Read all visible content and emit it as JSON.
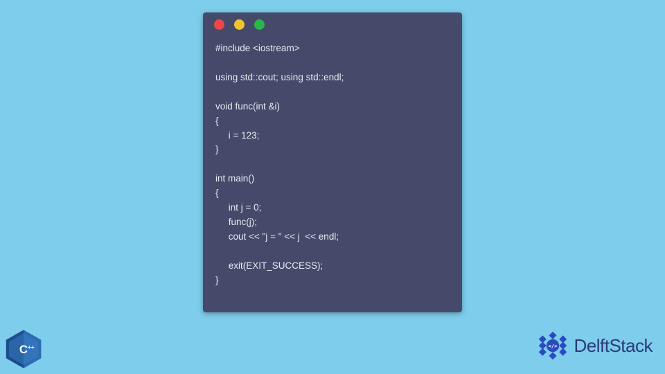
{
  "window": {
    "dots": {
      "red": "#ed4747",
      "yellow": "#f0c22e",
      "green": "#2bb64a"
    }
  },
  "code": {
    "lines": "#include <iostream>\n\nusing std::cout; using std::endl;\n\nvoid func(int &i)\n{\n     i = 123;\n}\n\nint main()\n{\n     int j = 0;\n     func(j);\n     cout << \"j = \" << j  << endl;\n\n     exit(EXIT_SUCCESS);\n}"
  },
  "cpp_badge": {
    "label": "C++"
  },
  "brand": {
    "name": "DelftStack"
  }
}
